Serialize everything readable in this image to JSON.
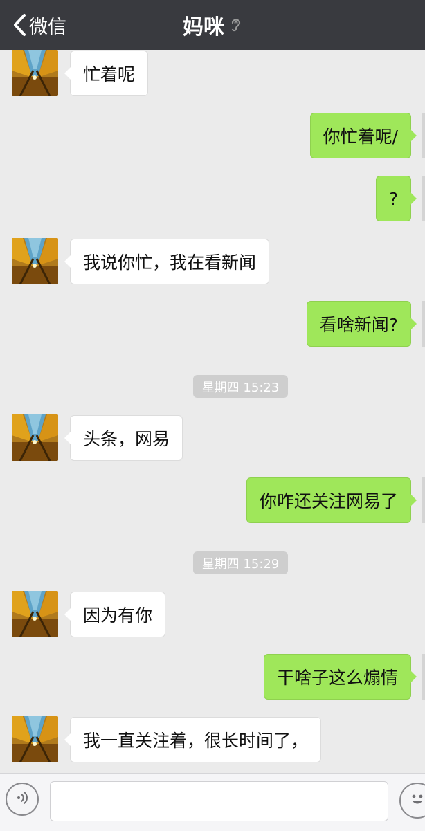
{
  "header": {
    "back_label": "微信",
    "title": "妈咪",
    "back_icon": "chevron-left-icon",
    "mode_icon": "earpiece-icon"
  },
  "messages": [
    {
      "side": "in",
      "text": "忙着呢"
    },
    {
      "side": "out",
      "text": "你忙着呢/"
    },
    {
      "side": "out",
      "text": "?"
    },
    {
      "side": "in",
      "text": "我说你忙，我在看新闻"
    },
    {
      "side": "out",
      "text": "看啥新闻?"
    },
    {
      "type": "time",
      "text": "星期四 15:23"
    },
    {
      "side": "in",
      "text": "头条，网易"
    },
    {
      "side": "out",
      "text": "你咋还关注网易了"
    },
    {
      "type": "time",
      "text": "星期四 15:29"
    },
    {
      "side": "in",
      "text": "因为有你"
    },
    {
      "side": "out",
      "text": "干啥子这么煽情"
    },
    {
      "side": "in",
      "text": "我一直关注着，很长时间了，"
    }
  ],
  "input_bar": {
    "voice_icon": "voice-icon",
    "emoji_icon": "emoji-icon",
    "text_value": ""
  },
  "colors": {
    "header_bg": "#393a3f",
    "chat_bg": "#ebebeb",
    "outgoing_bubble": "#9fe75a",
    "incoming_bubble": "#ffffff",
    "timestamp_bg": "#cecece"
  }
}
